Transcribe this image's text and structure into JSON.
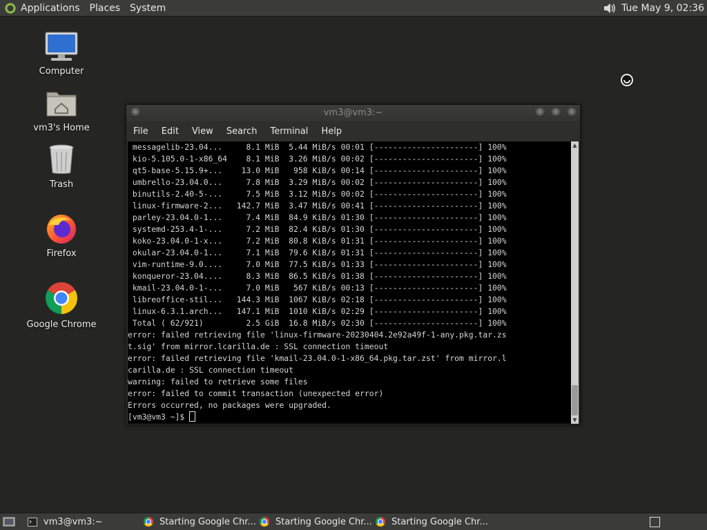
{
  "top_panel": {
    "menus": [
      "Applications",
      "Places",
      "System"
    ],
    "clock": "Tue May  9, 02:36"
  },
  "desktop": {
    "icons": [
      {
        "label": "Computer",
        "icon": "computer-icon"
      },
      {
        "label": "vm3's Home",
        "icon": "home-folder-icon"
      },
      {
        "label": "Trash",
        "icon": "trash-icon"
      },
      {
        "label": "Firefox",
        "icon": "firefox-icon"
      },
      {
        "label": "Google Chrome",
        "icon": "chrome-icon"
      }
    ]
  },
  "terminal": {
    "title": "vm3@vm3:~",
    "menu": [
      "File",
      "Edit",
      "View",
      "Search",
      "Terminal",
      "Help"
    ],
    "lines": [
      " messagelib-23.04...     8.1 MiB  5.44 MiB/s 00:01 [----------------------] 100%",
      " kio-5.105.0-1-x86_64    8.1 MiB  3.26 MiB/s 00:02 [----------------------] 100%",
      " qt5-base-5.15.9+...    13.0 MiB   958 KiB/s 00:14 [----------------------] 100%",
      " umbrello-23.04.0...     7.8 MiB  3.29 MiB/s 00:02 [----------------------] 100%",
      " binutils-2.40-5-...     7.5 MiB  3.12 MiB/s 00:02 [----------------------] 100%",
      " linux-firmware-2...   142.7 MiB  3.47 MiB/s 00:41 [----------------------] 100%",
      " parley-23.04.0-1...     7.4 MiB  84.9 KiB/s 01:30 [----------------------] 100%",
      " systemd-253.4-1-...     7.2 MiB  82.4 KiB/s 01:30 [----------------------] 100%",
      " koko-23.04.0-1-x...     7.2 MiB  80.8 KiB/s 01:31 [----------------------] 100%",
      " okular-23.04.0-1...     7.1 MiB  79.6 KiB/s 01:31 [----------------------] 100%",
      " vim-runtime-9.0....     7.0 MiB  77.5 KiB/s 01:33 [----------------------] 100%",
      " konqueror-23.04....     8.3 MiB  86.5 KiB/s 01:38 [----------------------] 100%",
      " kmail-23.04.0-1-...     7.0 MiB   567 KiB/s 00:13 [----------------------] 100%",
      " libreoffice-stil...   144.3 MiB  1067 KiB/s 02:18 [----------------------] 100%",
      " linux-6.3.1.arch...   147.1 MiB  1010 KiB/s 02:29 [----------------------] 100%",
      " Total ( 62/921)         2.5 GiB  16.8 MiB/s 02:30 [----------------------] 100%",
      "error: failed retrieving file 'linux-firmware-20230404.2e92a49f-1-any.pkg.tar.zs",
      "t.sig' from mirror.lcarilla.de : SSL connection timeout",
      "error: failed retrieving file 'kmail-23.04.0-1-x86_64.pkg.tar.zst' from mirror.l",
      "carilla.de : SSL connection timeout",
      "warning: failed to retrieve some files",
      "error: failed to commit transaction (unexpected error)",
      "Errors occurred, no packages were upgraded."
    ],
    "prompt": "[vm3@vm3 ~]$ "
  },
  "taskbar": {
    "tasks": [
      {
        "label": "vm3@vm3:~",
        "icon": "terminal-icon"
      },
      {
        "label": "Starting Google Chr...",
        "icon": "chrome-icon"
      },
      {
        "label": "Starting Google Chr...",
        "icon": "chrome-icon"
      },
      {
        "label": "Starting Google Chr...",
        "icon": "chrome-icon"
      }
    ]
  }
}
